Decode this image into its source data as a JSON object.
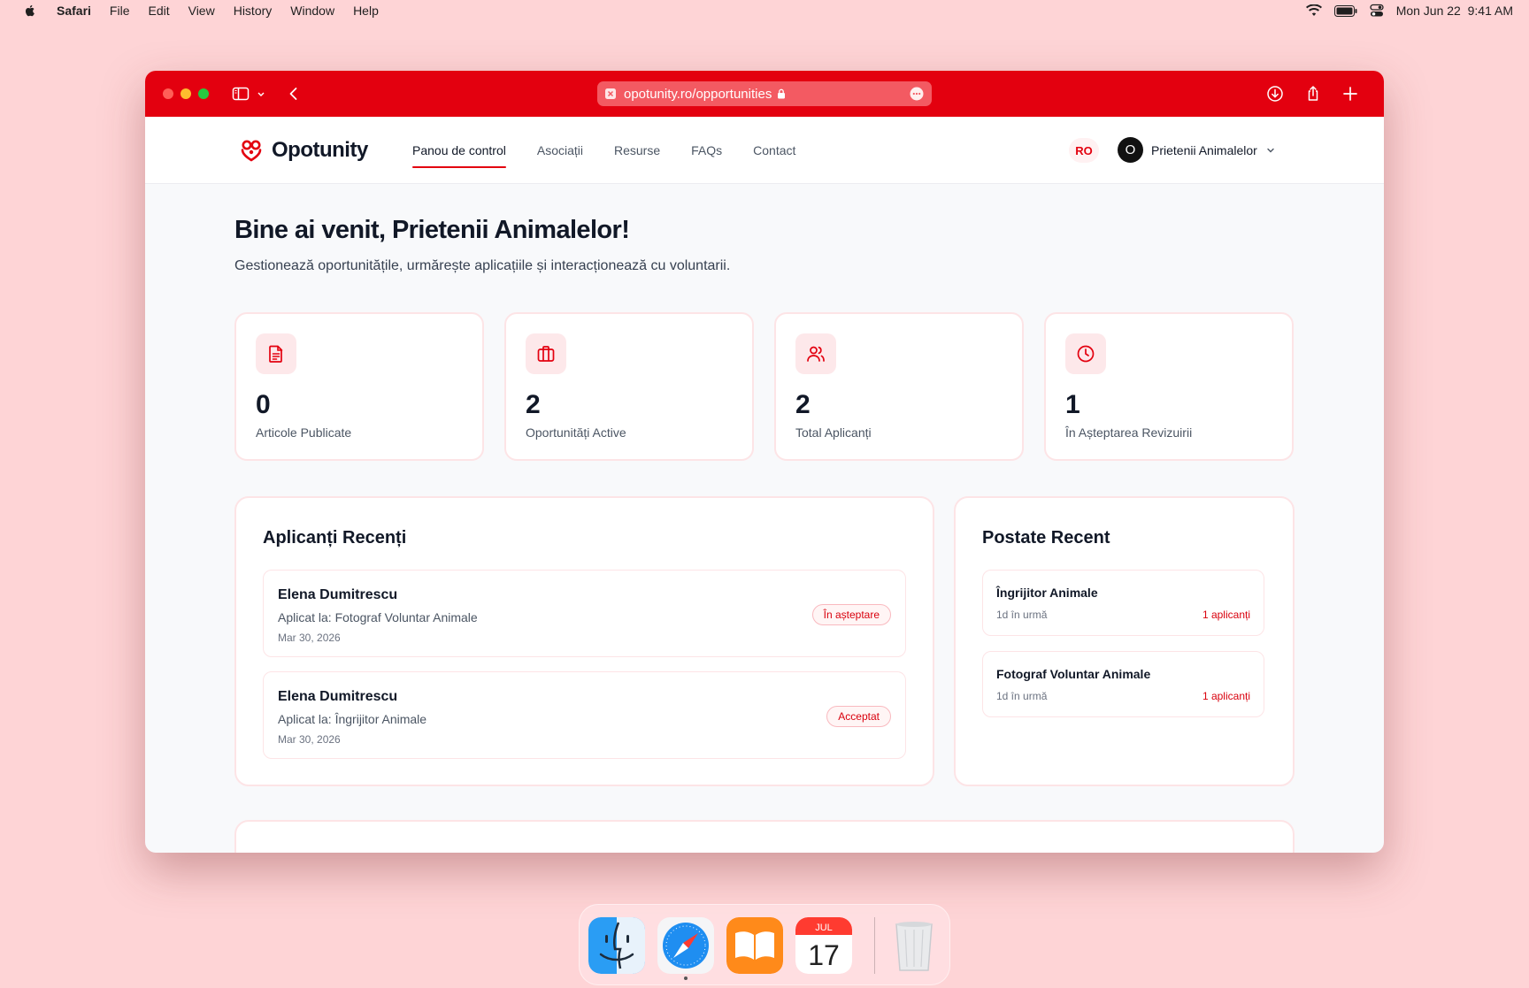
{
  "menubar": {
    "app_name": "Safari",
    "items": [
      "File",
      "Edit",
      "View",
      "History",
      "Window",
      "Help"
    ],
    "datetime": "Mon Jun 22  9:41 AM"
  },
  "browser": {
    "url": "opotunity.ro/opportunities",
    "toolbar_color": "#e3000f"
  },
  "site": {
    "brand": "Opotunity",
    "accent": "#e3000f",
    "nav": [
      {
        "label": "Panou de control",
        "active": true
      },
      {
        "label": "Asociații",
        "active": false
      },
      {
        "label": "Resurse",
        "active": false
      },
      {
        "label": "FAQs",
        "active": false
      },
      {
        "label": "Contact",
        "active": false
      }
    ],
    "language": "RO",
    "user": {
      "initial": "O",
      "name": "Prietenii Animalelor"
    }
  },
  "dashboard": {
    "title": "Bine ai venit, Prietenii Animalelor!",
    "subtitle": "Gestionează oportunitățile, urmărește aplicațiile și interacționează cu voluntarii.",
    "stats": [
      {
        "icon": "document-icon",
        "value": "0",
        "label": "Articole Publicate"
      },
      {
        "icon": "briefcase-icon",
        "value": "2",
        "label": "Oportunități Active"
      },
      {
        "icon": "users-icon",
        "value": "2",
        "label": "Total Aplicanți"
      },
      {
        "icon": "clock-icon",
        "value": "1",
        "label": "În Așteptarea Revizuirii"
      }
    ],
    "recent_applicants": {
      "title": "Aplicanți Recenți",
      "items": [
        {
          "name": "Elena Dumitrescu",
          "applied_to": "Aplicat la: Fotograf Voluntar Animale",
          "date": "Mar 30, 2026",
          "status": "În așteptare"
        },
        {
          "name": "Elena Dumitrescu",
          "applied_to": "Aplicat la: Îngrijitor Animale",
          "date": "Mar 30, 2026",
          "status": "Acceptat"
        }
      ]
    },
    "recent_posts": {
      "title": "Postate Recent",
      "items": [
        {
          "title": "Îngrijitor Animale",
          "age": "1d în urmă",
          "applicants": "1 aplicanți"
        },
        {
          "title": "Fotograf Voluntar Animale",
          "age": "1d în urmă",
          "applicants": "1 aplicanți"
        }
      ]
    }
  },
  "dock": {
    "calendar_month": "JUL",
    "calendar_day": "17",
    "apps": [
      "finder-icon",
      "safari-icon",
      "books-icon",
      "calendar-icon",
      "trash-icon"
    ]
  }
}
